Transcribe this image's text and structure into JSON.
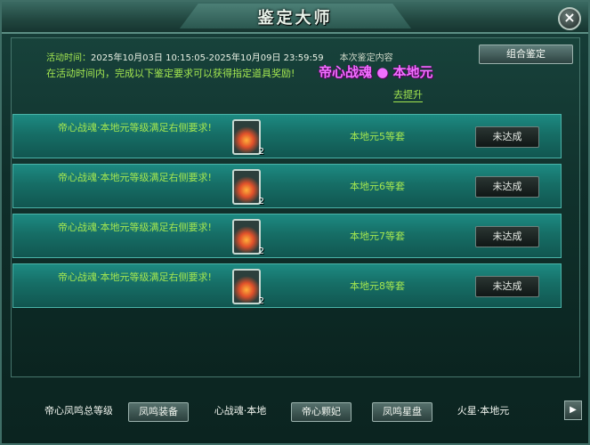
{
  "window": {
    "title": "鉴定大师"
  },
  "info": {
    "time_label": "活动时间：",
    "time_value": "2025年10月03日 10:15:05-2025年10月09日 23:59:59",
    "content_label": "本次鉴定内容",
    "desc": "在活动时间内，完成以下鉴定要求可以获得指定道具奖励!",
    "award": "帝心战魂 ● 本地元"
  },
  "combo_button": "组合鉴定",
  "go_link": "去提升",
  "rows": [
    {
      "req": "帝心战魂·本地元等级满足右侧要求!",
      "count": "2",
      "level": "本地元5等套",
      "status": "未达成"
    },
    {
      "req": "帝心战魂·本地元等级满足右侧要求!",
      "count": "2",
      "level": "本地元6等套",
      "status": "未达成"
    },
    {
      "req": "帝心战魂·本地元等级满足右侧要求!",
      "count": "2",
      "level": "本地元7等套",
      "status": "未达成"
    },
    {
      "req": "帝心战魂·本地元等级满足右侧要求!",
      "count": "2",
      "level": "本地元8等套",
      "status": "未达成"
    }
  ],
  "tabs": [
    "帝心凤鸣总等级",
    "凤鸣装备",
    "心战魂·本地",
    "帝心颗妃",
    "凤鸣星盘",
    "火星·本地元"
  ],
  "next_icon": "play-right-icon",
  "colors": {
    "accent": "#a3e650",
    "award": "#f070ff",
    "row": "#166e66"
  }
}
